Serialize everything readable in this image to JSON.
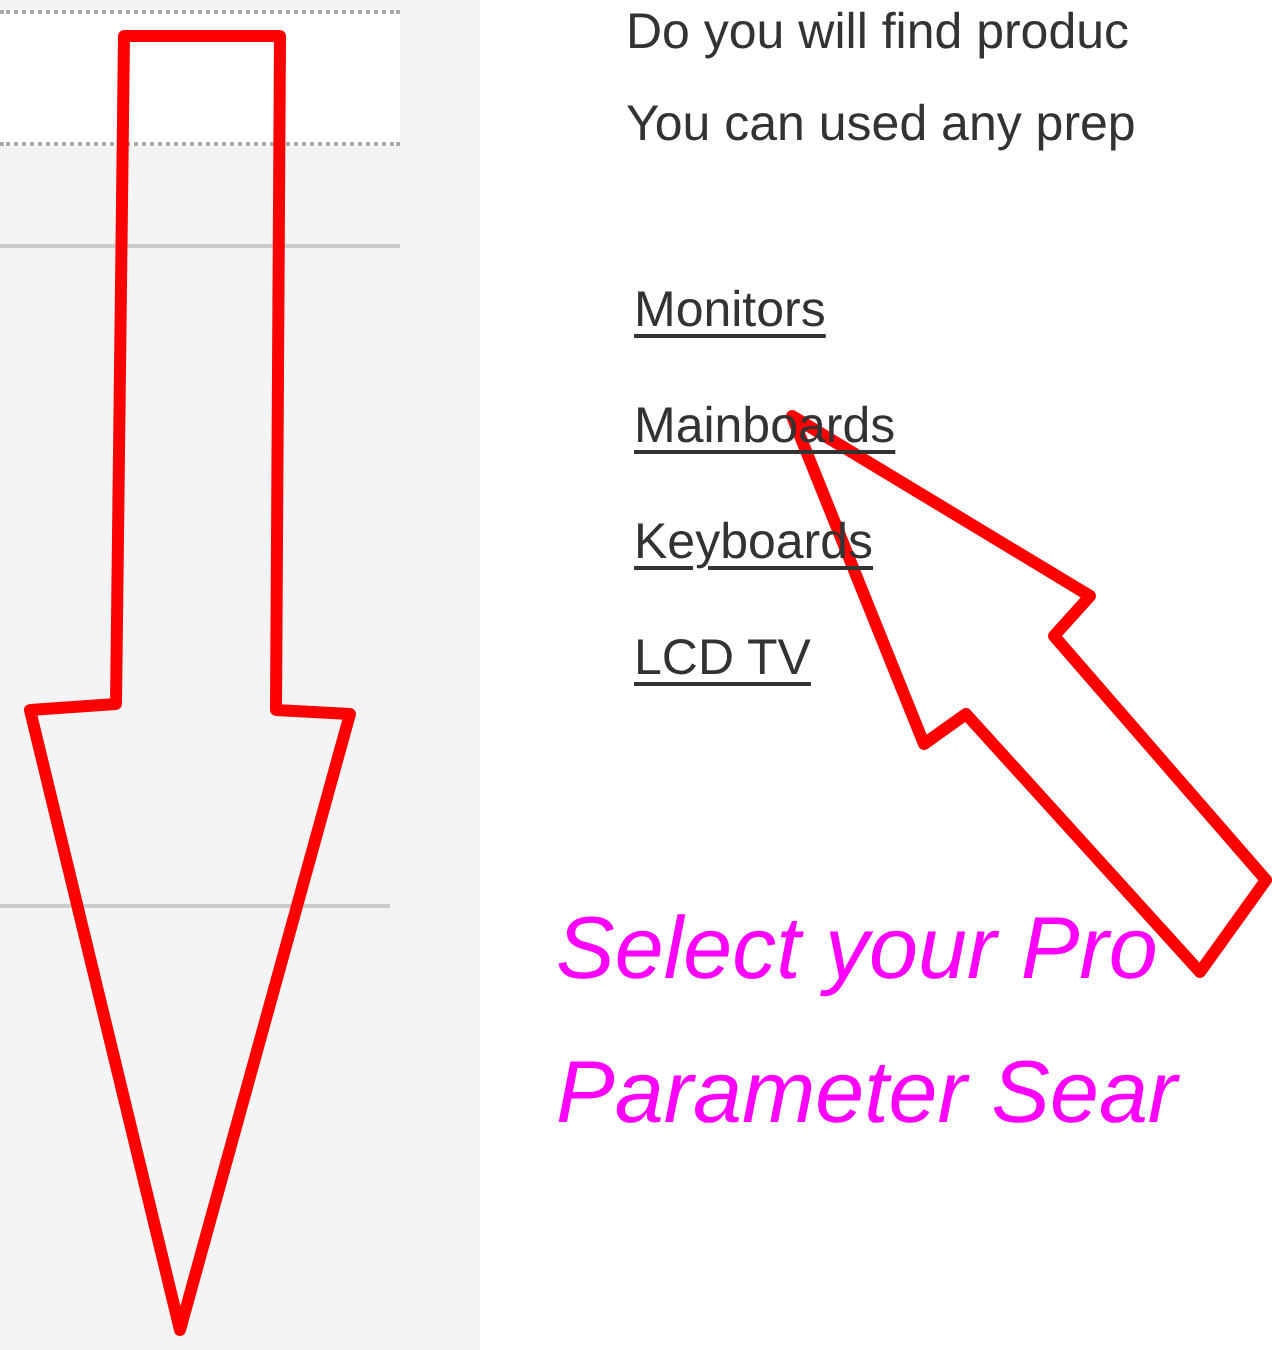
{
  "intro": [
    "Do you will find produc",
    "You can used any prep"
  ],
  "categories": [
    {
      "label": "Monitors"
    },
    {
      "label": "Mainboards"
    },
    {
      "label": "Keyboards"
    },
    {
      "label": "LCD TV"
    }
  ],
  "callout": [
    "Select your Pro",
    "Parameter Sear"
  ]
}
